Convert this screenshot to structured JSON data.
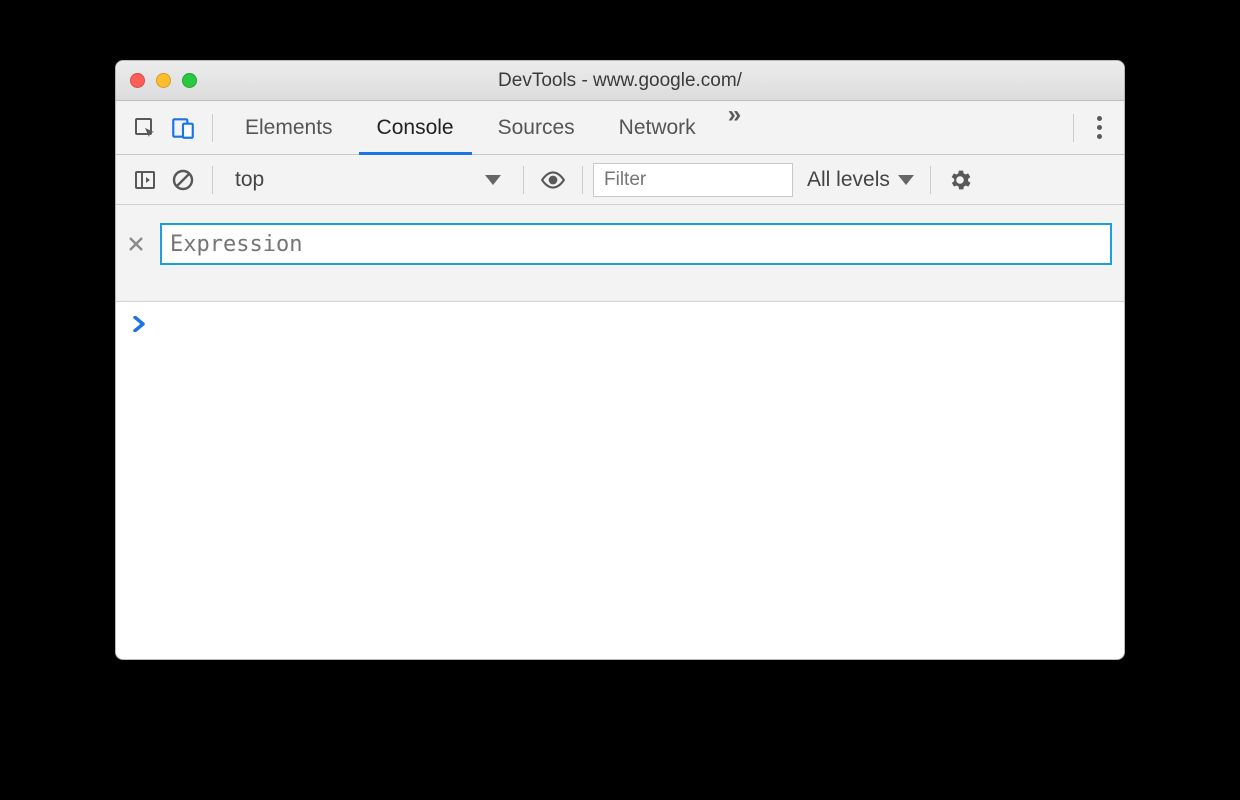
{
  "window": {
    "title": "DevTools - www.google.com/"
  },
  "tabs": {
    "items": [
      {
        "label": "Elements",
        "active": false
      },
      {
        "label": "Console",
        "active": true
      },
      {
        "label": "Sources",
        "active": false
      },
      {
        "label": "Network",
        "active": false
      }
    ],
    "overflow_glyph": "»"
  },
  "console_toolbar": {
    "context": "top",
    "filter_placeholder": "Filter",
    "log_levels_label": "All levels"
  },
  "expression": {
    "placeholder": "Expression",
    "value": ""
  },
  "prompt_glyph": "›"
}
